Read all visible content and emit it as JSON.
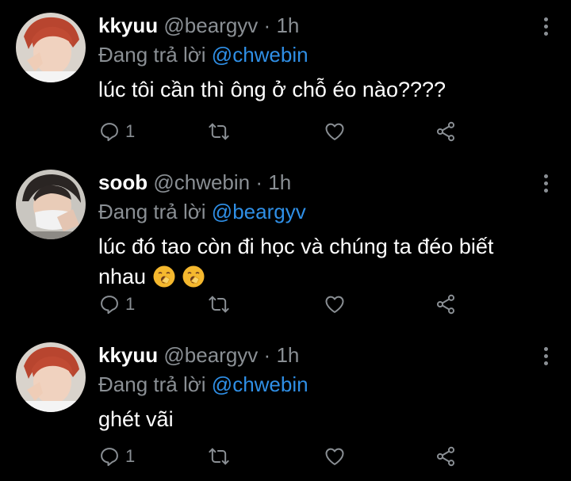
{
  "tweets": [
    {
      "name": "kkyuu",
      "handle": "@beargyv",
      "dot": "·",
      "time": "1h",
      "reply_prefix": "Đang trả lời",
      "reply_to": "@chwebin",
      "text": "lúc tôi cần thì ông ở chỗ éo nào????",
      "reply_count": "1"
    },
    {
      "name": "soob",
      "handle": "@chwebin",
      "dot": "·",
      "time": "1h",
      "reply_prefix": "Đang trả lời",
      "reply_to": "@beargyv",
      "text_line1": "lúc đó tao còn đi học và chúng ta đéo biết",
      "text_line2": "nhau",
      "emoji": "yawning-face",
      "reply_count": "1"
    },
    {
      "name": "kkyuu",
      "handle": "@beargyv",
      "dot": "·",
      "time": "1h",
      "reply_prefix": "Đang trả lời",
      "reply_to": "@chwebin",
      "text": "ghét vãi",
      "reply_count": "1"
    }
  ],
  "colors": {
    "background": "#000000",
    "name": "#ffffff",
    "secondary": "#8a8f94",
    "mention": "#2f8fe6"
  },
  "icons": [
    "reply-icon",
    "retweet-icon",
    "like-icon",
    "share-icon",
    "more-icon"
  ]
}
